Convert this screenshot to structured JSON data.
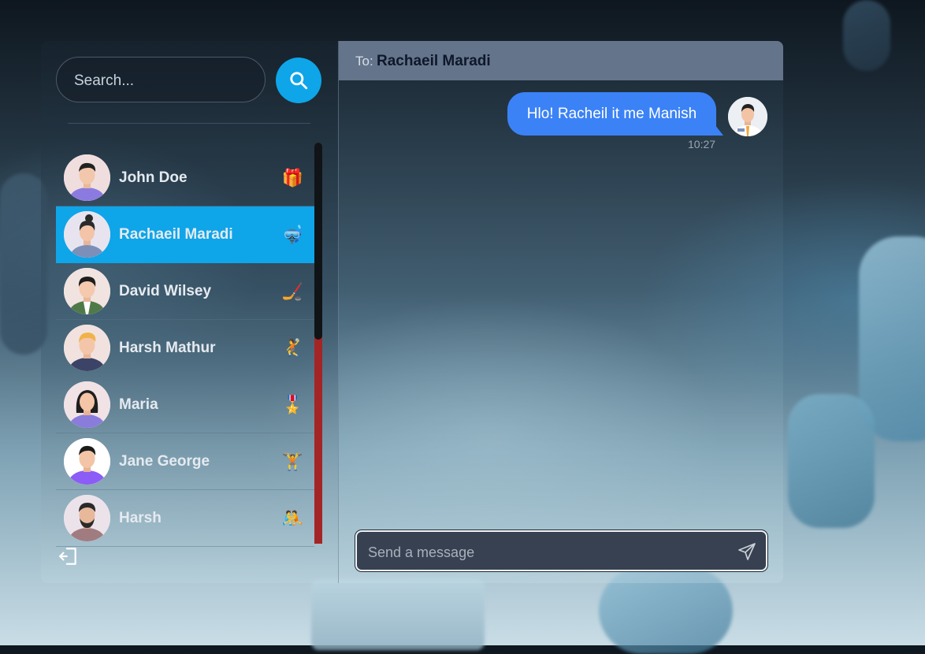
{
  "search": {
    "placeholder": "Search..."
  },
  "contacts": [
    {
      "name": "John Doe",
      "emoji": "🎁",
      "active": false
    },
    {
      "name": "Rachaeil Maradi",
      "emoji": "🤿",
      "active": true
    },
    {
      "name": "David Wilsey",
      "emoji": "🏒",
      "active": false
    },
    {
      "name": "Harsh Mathur",
      "emoji": "🤾",
      "active": false
    },
    {
      "name": "Maria",
      "emoji": "🎖️",
      "active": false
    },
    {
      "name": "Jane George",
      "emoji": "🏋️",
      "active": false
    },
    {
      "name": "Harsh",
      "emoji": "🤼",
      "active": false
    }
  ],
  "chat": {
    "to_label": "To:",
    "to_name": "Rachaeil Maradi",
    "messages": [
      {
        "text": "Hlo! Racheil it me Manish",
        "time": "10:27"
      }
    ],
    "composer_placeholder": "Send a message"
  },
  "colors": {
    "accent": "#0ea5e9",
    "bubble": "#3b82f6",
    "header": "#64748b",
    "scroll_track": "#a42525"
  },
  "icons": [
    "search-icon",
    "logout-icon",
    "send-icon"
  ]
}
